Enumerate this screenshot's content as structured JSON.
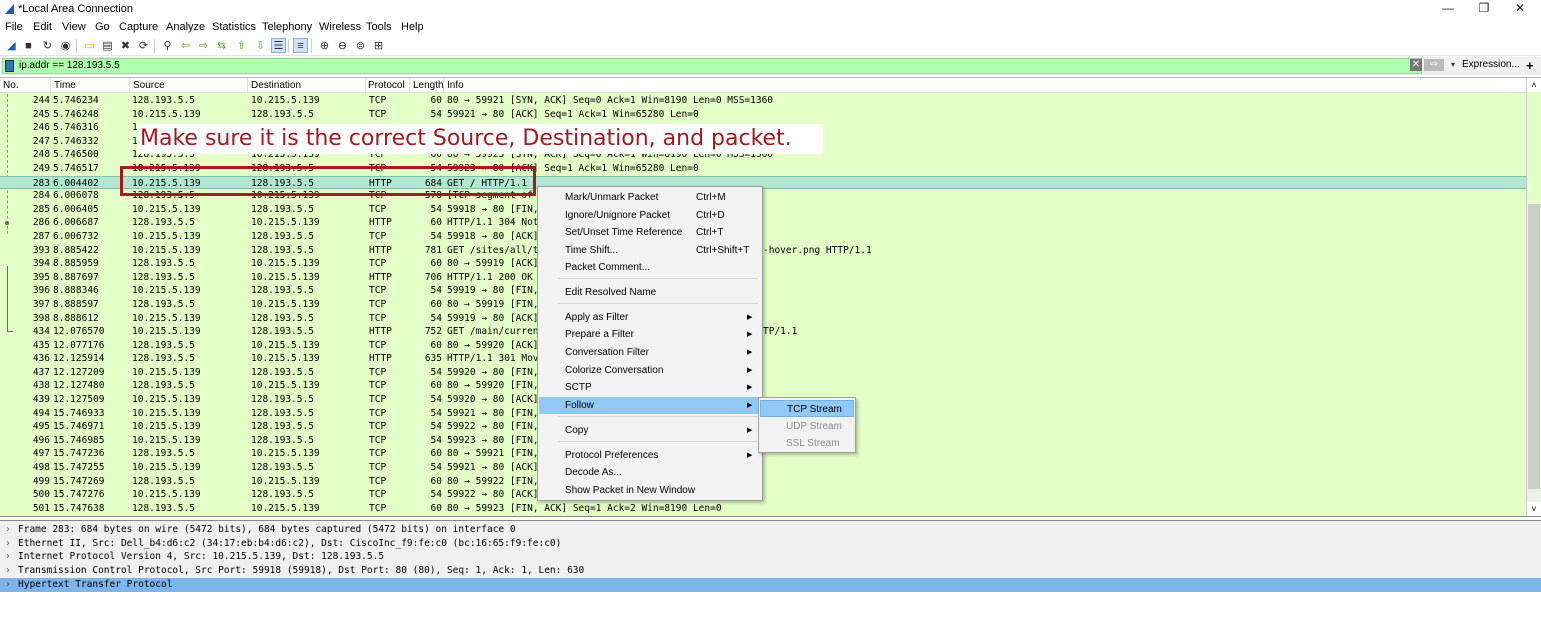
{
  "window": {
    "title": "*Local Area Connection",
    "controls": {
      "minimize": "—",
      "maximize": "❐",
      "close": "✕"
    }
  },
  "menu": [
    {
      "label": "File"
    },
    {
      "label": "Edit"
    },
    {
      "label": "View"
    },
    {
      "label": "Go"
    },
    {
      "label": "Capture"
    },
    {
      "label": "Analyze"
    },
    {
      "label": "Statistics"
    },
    {
      "label": "Telephony"
    },
    {
      "label": "Wireless"
    },
    {
      "label": "Tools"
    },
    {
      "label": "Help"
    }
  ],
  "toolbar": {
    "icons": [
      {
        "name": "start-capture-icon",
        "glyph": "◢"
      },
      {
        "name": "stop-capture-icon",
        "glyph": "■"
      },
      {
        "name": "restart-capture-icon",
        "glyph": "↻"
      },
      {
        "name": "capture-options-icon",
        "glyph": "◉"
      },
      {
        "name": "open-file-icon",
        "glyph": "▭"
      },
      {
        "name": "save-file-icon",
        "glyph": "▤"
      },
      {
        "name": "close-file-icon",
        "glyph": "✖"
      },
      {
        "name": "reload-file-icon",
        "glyph": "⟳"
      },
      {
        "name": "find-packet-icon",
        "glyph": "⚲"
      },
      {
        "name": "go-back-icon",
        "glyph": "⇦"
      },
      {
        "name": "go-forward-icon",
        "glyph": "⇨"
      },
      {
        "name": "go-to-packet-icon",
        "glyph": "⇆"
      },
      {
        "name": "go-first-packet-icon",
        "glyph": "⇧"
      },
      {
        "name": "go-last-packet-icon",
        "glyph": "⇩"
      },
      {
        "name": "autoscroll-icon",
        "glyph": "☰"
      },
      {
        "name": "colorize-icon",
        "glyph": "≡"
      },
      {
        "name": "zoom-in-icon",
        "glyph": "⊕"
      },
      {
        "name": "zoom-out-icon",
        "glyph": "⊖"
      },
      {
        "name": "zoom-normal-icon",
        "glyph": "⊜"
      },
      {
        "name": "resize-columns-icon",
        "glyph": "⊞"
      }
    ]
  },
  "filter": {
    "value": "ip.addr == 128.193.5.5",
    "clear": "✕",
    "apply": "⇨",
    "dropdown": "▾",
    "expression_label": "Expression...",
    "add_label": "+"
  },
  "packet_list": {
    "columns": [
      "No.",
      "Time",
      "Source",
      "Destination",
      "Protocol",
      "Length",
      "Info"
    ],
    "rows": [
      {
        "no": "244",
        "time": "5.746234",
        "src": "128.193.5.5",
        "dst": "10.215.5.139",
        "proto": "TCP",
        "len": "60",
        "info": "80 → 59921 [SYN, ACK] Seq=0 Ack=1 Win=8190 Len=0 MSS=1360"
      },
      {
        "no": "245",
        "time": "5.746248",
        "src": "10.215.5.139",
        "dst": "128.193.5.5",
        "proto": "TCP",
        "len": "54",
        "info": "59921 → 80 [ACK] Seq=1 Ack=1 Win=65280 Len=0"
      },
      {
        "no": "246",
        "time": "5.746316",
        "src": "1",
        "dst": "",
        "proto": "",
        "len": "",
        "info": ""
      },
      {
        "no": "247",
        "time": "5.746332",
        "src": "1",
        "dst": "",
        "proto": "",
        "len": "",
        "info": ""
      },
      {
        "no": "248",
        "time": "5.746500",
        "src": "128.193.5.5",
        "dst": "10.215.5.139",
        "proto": "TCP",
        "len": "60",
        "info": "80 → 59923 [SYN, ACK] Seq=0 Ack=1 Win=8190 Len=0 MSS=1360"
      },
      {
        "no": "249",
        "time": "5.746517",
        "src": "10.215.5.139",
        "dst": "128.193.5.5",
        "proto": "TCP",
        "len": "54",
        "info": "59923 → 80 [ACK] Seq=1 Ack=1 Win=65280 Len=0"
      },
      {
        "no": "283",
        "time": "6.004402",
        "src": "10.215.5.139",
        "dst": "128.193.5.5",
        "proto": "HTTP",
        "len": "684",
        "info": "GET / HTTP/1.1",
        "selected": true
      },
      {
        "no": "284",
        "time": "6.006078",
        "src": "128.193.5.5",
        "dst": "10.215.5.139",
        "proto": "TCP",
        "len": "578",
        "info": "[TCP segment of"
      },
      {
        "no": "285",
        "time": "6.006405",
        "src": "10.215.5.139",
        "dst": "128.193.5.5",
        "proto": "TCP",
        "len": "54",
        "info": "59918 → 80 [FIN,"
      },
      {
        "no": "286",
        "time": "6.006687",
        "src": "128.193.5.5",
        "dst": "10.215.5.139",
        "proto": "HTTP",
        "len": "60",
        "info": "HTTP/1.1 304 Not"
      },
      {
        "no": "287",
        "time": "6.006732",
        "src": "10.215.5.139",
        "dst": "128.193.5.5",
        "proto": "TCP",
        "len": "54",
        "info": "59918 → 80 [ACK]"
      },
      {
        "no": "393",
        "time": "8.885422",
        "src": "10.215.5.139",
        "dst": "128.193.5.5",
        "proto": "HTTP",
        "len": "781",
        "info": "GET /sites/all/t",
        "info_tail": "-hover.png HTTP/1.1"
      },
      {
        "no": "394",
        "time": "8.885959",
        "src": "128.193.5.5",
        "dst": "10.215.5.139",
        "proto": "TCP",
        "len": "60",
        "info": "80 → 59919 [ACK]"
      },
      {
        "no": "395",
        "time": "8.887697",
        "src": "128.193.5.5",
        "dst": "10.215.5.139",
        "proto": "HTTP",
        "len": "706",
        "info": "HTTP/1.1 200 OK"
      },
      {
        "no": "396",
        "time": "8.888346",
        "src": "10.215.5.139",
        "dst": "128.193.5.5",
        "proto": "TCP",
        "len": "54",
        "info": "59919 → 80 [FIN,"
      },
      {
        "no": "397",
        "time": "8.888597",
        "src": "128.193.5.5",
        "dst": "10.215.5.139",
        "proto": "TCP",
        "len": "60",
        "info": "80 → 59919 [FIN,"
      },
      {
        "no": "398",
        "time": "8.888612",
        "src": "10.215.5.139",
        "dst": "128.193.5.5",
        "proto": "TCP",
        "len": "54",
        "info": "59919 → 80 [ACK]"
      },
      {
        "no": "434",
        "time": "12.076570",
        "src": "10.215.5.139",
        "dst": "128.193.5.5",
        "proto": "HTTP",
        "len": "752",
        "info": "GET /main/curren",
        "info_tail": "TP/1.1"
      },
      {
        "no": "435",
        "time": "12.077176",
        "src": "128.193.5.5",
        "dst": "10.215.5.139",
        "proto": "TCP",
        "len": "60",
        "info": "80 → 59920 [ACK]"
      },
      {
        "no": "436",
        "time": "12.125914",
        "src": "128.193.5.5",
        "dst": "10.215.5.139",
        "proto": "HTTP",
        "len": "635",
        "info": "HTTP/1.1 301 Mov"
      },
      {
        "no": "437",
        "time": "12.127209",
        "src": "10.215.5.139",
        "dst": "128.193.5.5",
        "proto": "TCP",
        "len": "54",
        "info": "59920 → 80 [FIN,"
      },
      {
        "no": "438",
        "time": "12.127480",
        "src": "128.193.5.5",
        "dst": "10.215.5.139",
        "proto": "TCP",
        "len": "60",
        "info": "80 → 59920 [FIN,"
      },
      {
        "no": "439",
        "time": "12.127509",
        "src": "10.215.5.139",
        "dst": "128.193.5.5",
        "proto": "TCP",
        "len": "54",
        "info": "59920 → 80 [ACK]"
      },
      {
        "no": "494",
        "time": "15.746933",
        "src": "10.215.5.139",
        "dst": "128.193.5.5",
        "proto": "TCP",
        "len": "54",
        "info": "59921 → 80 [FIN,"
      },
      {
        "no": "495",
        "time": "15.746971",
        "src": "10.215.5.139",
        "dst": "128.193.5.5",
        "proto": "TCP",
        "len": "54",
        "info": "59922 → 80 [FIN,"
      },
      {
        "no": "496",
        "time": "15.746985",
        "src": "10.215.5.139",
        "dst": "128.193.5.5",
        "proto": "TCP",
        "len": "54",
        "info": "59923 → 80 [FIN,"
      },
      {
        "no": "497",
        "time": "15.747236",
        "src": "128.193.5.5",
        "dst": "10.215.5.139",
        "proto": "TCP",
        "len": "60",
        "info": "80 → 59921 [FIN,"
      },
      {
        "no": "498",
        "time": "15.747255",
        "src": "10.215.5.139",
        "dst": "128.193.5.5",
        "proto": "TCP",
        "len": "54",
        "info": "59921 → 80 [ACK]"
      },
      {
        "no": "499",
        "time": "15.747269",
        "src": "128.193.5.5",
        "dst": "10.215.5.139",
        "proto": "TCP",
        "len": "60",
        "info": "80 → 59922 [FIN,"
      },
      {
        "no": "500",
        "time": "15.747276",
        "src": "10.215.5.139",
        "dst": "128.193.5.5",
        "proto": "TCP",
        "len": "54",
        "info": "59922 → 80 [ACK]"
      },
      {
        "no": "501",
        "time": "15.747638",
        "src": "128.193.5.5",
        "dst": "10.215.5.139",
        "proto": "TCP",
        "len": "60",
        "info": "80 → 59923 [FIN, ACK] Seq=1 Ack=2 Win=8190 Len=0"
      }
    ],
    "scroll": {
      "up": "˄",
      "down": "˅"
    }
  },
  "annotation": {
    "text": "Make sure it is the correct Source, Destination, and packet.",
    "color": "#a01c20"
  },
  "context_menu": {
    "items": [
      {
        "label": "Mark/Unmark Packet",
        "shortcut": "Ctrl+M"
      },
      {
        "label": "Ignore/Unignore Packet",
        "shortcut": "Ctrl+D"
      },
      {
        "label": "Set/Unset Time Reference",
        "shortcut": "Ctrl+T"
      },
      {
        "label": "Time Shift...",
        "shortcut": "Ctrl+Shift+T"
      },
      {
        "label": "Packet Comment...",
        "shortcut": ""
      },
      {
        "label": "Edit Resolved Name",
        "shortcut": ""
      },
      {
        "label": "Apply as Filter",
        "submenu": true
      },
      {
        "label": "Prepare a Filter",
        "submenu": true
      },
      {
        "label": "Conversation Filter",
        "submenu": true
      },
      {
        "label": "Colorize Conversation",
        "submenu": true
      },
      {
        "label": "SCTP",
        "submenu": true
      },
      {
        "label": "Follow",
        "submenu": true,
        "highlighted": true
      },
      {
        "label": "Copy",
        "submenu": true
      },
      {
        "label": "Protocol Preferences",
        "submenu": true
      },
      {
        "label": "Decode As...",
        "shortcut": ""
      },
      {
        "label": "Show Packet in New Window",
        "shortcut": ""
      }
    ],
    "submenu_arrow": "▶",
    "follow_submenu": [
      {
        "label": "TCP Stream",
        "highlighted": true
      },
      {
        "label": "UDP Stream",
        "disabled": true
      },
      {
        "label": "SSL Stream",
        "disabled": true
      }
    ]
  },
  "details": {
    "expander": "›",
    "rows": [
      {
        "text": "Frame 283: 684 bytes on wire (5472 bits), 684 bytes captured (5472 bits) on interface 0"
      },
      {
        "text": "Ethernet II, Src: Dell_b4:d6:c2 (34:17:eb:b4:d6:c2), Dst: CiscoInc_f9:fe:c0 (bc:16:65:f9:fe:c0)"
      },
      {
        "text": "Internet Protocol Version 4, Src: 10.215.5.139, Dst: 128.193.5.5"
      },
      {
        "text": "Transmission Control Protocol, Src Port: 59918 (59918), Dst Port: 80 (80), Seq: 1, Ack: 1, Len: 630"
      },
      {
        "text": "Hypertext Transfer Protocol",
        "selected": true
      }
    ]
  },
  "colors": {
    "packet_bg": "#e4ffc7",
    "selected_row": "#b3e6d0",
    "filter_bg": "#afffaf",
    "menu_highlight": "#91c9f7",
    "detail_selected": "#7eb4ea"
  }
}
